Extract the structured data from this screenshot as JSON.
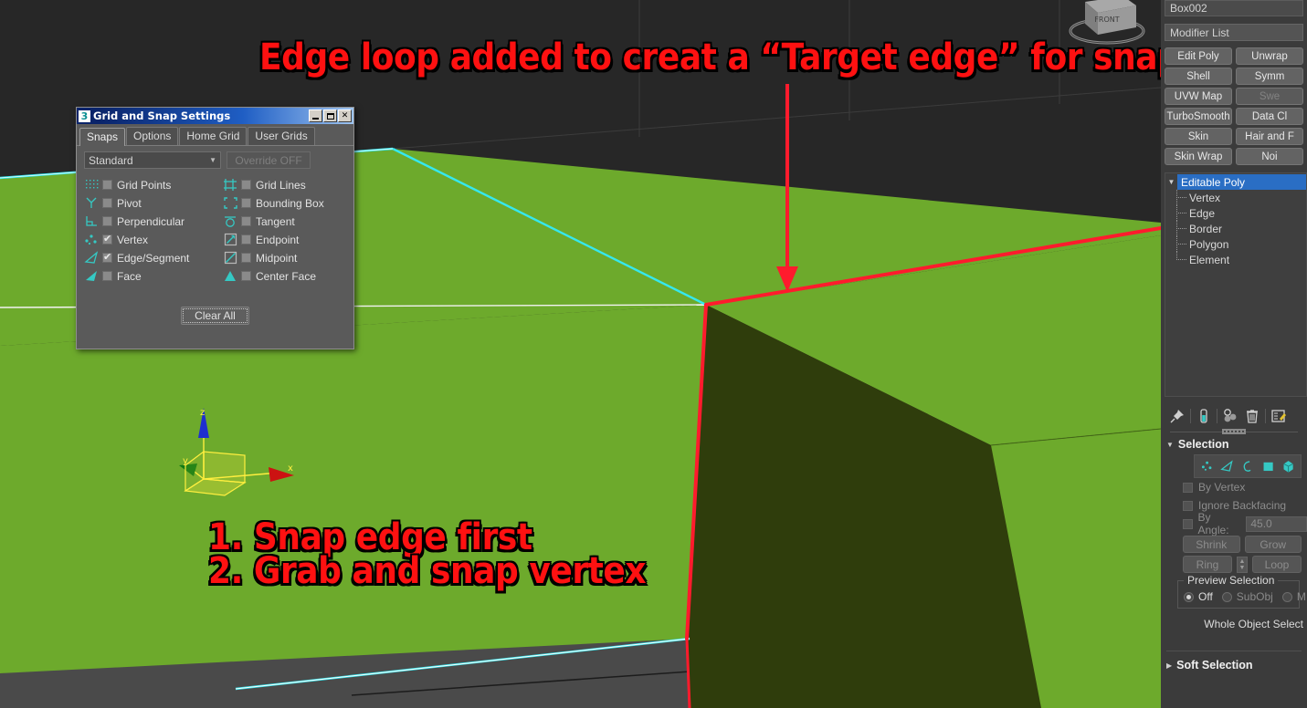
{
  "annotations": {
    "top": "Edge loop added to creat a “Target edge” for snap",
    "step1": "1. Snap edge first",
    "step2": "2. Grab and snap vertex"
  },
  "viewcube": {
    "front_label": "FRONT"
  },
  "gizmo": {
    "x_label": "x",
    "y_label": "y",
    "z_label": "z"
  },
  "snap_dialog": {
    "title": "Grid and Snap Settings",
    "icon": "max-app-icon",
    "window_buttons": {
      "minimize": "minimize-icon",
      "maximize": "maximize-icon",
      "close": "✕"
    },
    "tabs": [
      {
        "label": "Snaps",
        "active": true
      },
      {
        "label": "Options",
        "active": false
      },
      {
        "label": "Home Grid",
        "active": false
      },
      {
        "label": "User Grids",
        "active": false
      }
    ],
    "preset_value": "Standard",
    "caret": "▼",
    "override_label": "Override OFF",
    "snaps": [
      {
        "label": "Grid Points",
        "checked": false,
        "icon": "grid-points-icon"
      },
      {
        "label": "Grid Lines",
        "checked": false,
        "icon": "grid-lines-icon"
      },
      {
        "label": "Pivot",
        "checked": false,
        "icon": "pivot-icon"
      },
      {
        "label": "Bounding Box",
        "checked": false,
        "icon": "bounding-box-icon"
      },
      {
        "label": "Perpendicular",
        "checked": false,
        "icon": "perpendicular-icon"
      },
      {
        "label": "Tangent",
        "checked": false,
        "icon": "tangent-icon"
      },
      {
        "label": "Vertex",
        "checked": true,
        "icon": "vertex-icon"
      },
      {
        "label": "Endpoint",
        "checked": false,
        "icon": "endpoint-icon"
      },
      {
        "label": "Edge/Segment",
        "checked": true,
        "icon": "edge-segment-icon"
      },
      {
        "label": "Midpoint",
        "checked": false,
        "icon": "midpoint-icon"
      },
      {
        "label": "Face",
        "checked": false,
        "icon": "face-icon"
      },
      {
        "label": "Center Face",
        "checked": false,
        "icon": "center-face-icon"
      }
    ],
    "clear_all_label": "Clear All"
  },
  "command_panel": {
    "object_name": "Box002",
    "modifier_list_label": "Modifier List",
    "modifier_buttons": [
      {
        "label": "Edit Poly",
        "disabled": false
      },
      {
        "label": "Unwrap",
        "disabled": false
      },
      {
        "label": "Shell",
        "disabled": false
      },
      {
        "label": "Symm",
        "disabled": false
      },
      {
        "label": "UVW Map",
        "disabled": false
      },
      {
        "label": "Swe",
        "disabled": true
      },
      {
        "label": "TurboSmooth",
        "disabled": false
      },
      {
        "label": "Data Cl",
        "disabled": false
      },
      {
        "label": "Skin",
        "disabled": false
      },
      {
        "label": "Hair and F",
        "disabled": false
      },
      {
        "label": "Skin Wrap",
        "disabled": false
      },
      {
        "label": "Noi",
        "disabled": false
      }
    ],
    "stack": {
      "arrow": "▼",
      "root": "Editable Poly",
      "children": [
        "Vertex",
        "Edge",
        "Border",
        "Polygon",
        "Element"
      ]
    },
    "stack_tools": [
      {
        "name": "pin-stack-icon"
      },
      {
        "name": "show-end-result-icon"
      },
      {
        "name": "make-unique-icon"
      },
      {
        "name": "delete-modifier-icon"
      },
      {
        "name": "configure-sets-icon"
      }
    ],
    "selection": {
      "arrow": "▼",
      "title": "Selection",
      "subobject_icons": [
        "vertex-subobject-icon",
        "edge-subobject-icon",
        "border-subobject-icon",
        "polygon-subobject-icon",
        "element-subobject-icon"
      ],
      "by_vertex_label": "By Vertex",
      "by_vertex_checked": false,
      "ignore_backfacing_label": "Ignore Backfacing",
      "ignore_backfacing_checked": false,
      "by_angle_label": "By Angle:",
      "by_angle_checked": false,
      "by_angle_value": "45.0",
      "shrink_label": "Shrink",
      "grow_label": "Grow",
      "ring_label": "Ring",
      "loop_label": "Loop",
      "preview_selection_label": "Preview Selection",
      "preview_options": [
        {
          "label": "Off",
          "selected": true,
          "dim": false
        },
        {
          "label": "SubObj",
          "selected": false,
          "dim": true
        },
        {
          "label": "M",
          "selected": false,
          "dim": true
        }
      ],
      "status_text": "Whole Object Select"
    },
    "soft_selection": {
      "arrow": "▶",
      "title": "Soft Selection"
    }
  },
  "colors": {
    "viewport_background": "#272727",
    "mesh_green": "#6daa2c",
    "mesh_dark_green": "#2f3d0c",
    "floor_gray": "#4a4a4a",
    "selected_edge_red": "#ff1b2d",
    "open_edge_cyan": "#35e8ef",
    "annotation_red": "#fe1111",
    "panel_background": "#3b3b3b",
    "stack_highlight_blue": "#2a6ec4",
    "subobject_teal": "#35c9c4"
  }
}
